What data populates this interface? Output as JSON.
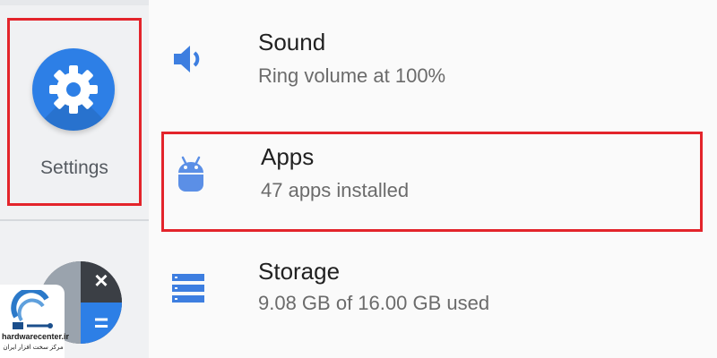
{
  "launcher": {
    "settings_app_label": "Settings",
    "calculator_symbols": {
      "times": "×",
      "equals": "="
    }
  },
  "settings_list": [
    {
      "title": "Sound",
      "subtitle": "Ring volume at 100%",
      "icon": "speaker-icon"
    },
    {
      "title": "Apps",
      "subtitle": "47 apps installed",
      "icon": "android-icon"
    },
    {
      "title": "Storage",
      "subtitle": "9.08 GB of 16.00 GB used",
      "icon": "storage-icon"
    }
  ],
  "watermark": {
    "site": "hardwarecenter.ir",
    "tagline": "مرکز سخت افزار ایران"
  },
  "colors": {
    "accent_blue": "#2d7fe6",
    "highlight_red": "#e3242b",
    "list_icon_blue": "#3d7ee0",
    "apps_icon_blue": "#5b8fe6"
  }
}
